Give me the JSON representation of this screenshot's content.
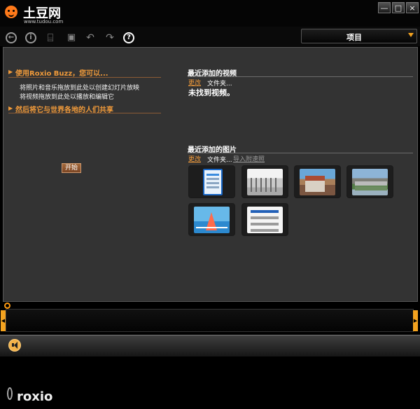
{
  "app": {
    "title": "土豆网",
    "url": "www.tudou.com"
  },
  "toolbar": {
    "project_label": "项目"
  },
  "left_panel": {
    "heading1": "使用Roxio Buzz，您可以...",
    "line1": "将照片和音乐拖放到此处以创建幻灯片放映",
    "line2": "将视频拖放到此处以播放和编辑它",
    "heading2": "然后将它与世界各地的人们共享",
    "start_button": "开始"
  },
  "videos": {
    "heading": "最近添加的视频",
    "change": "更改",
    "folder": "文件夹...",
    "message": "未找到视频。"
  },
  "pictures": {
    "heading": "最近添加的图片",
    "change": "更改",
    "folder": "文件夹...",
    "import": "导入附速照"
  },
  "bottom": {
    "brand": "roxio"
  },
  "colors": {
    "accent": "#f09a3a",
    "timeline_handle": "#f4a31f"
  }
}
